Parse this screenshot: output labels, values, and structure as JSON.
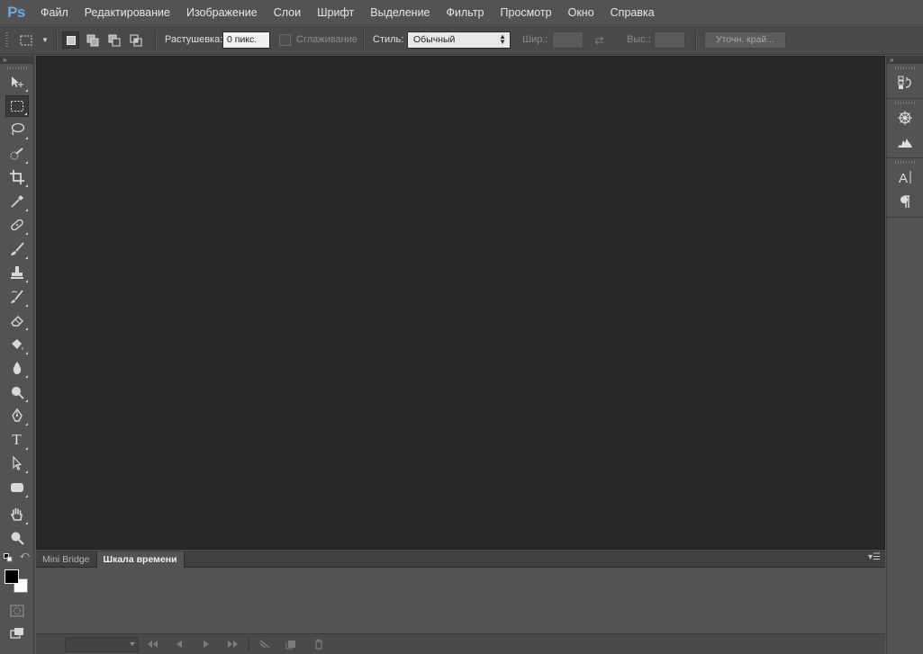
{
  "app": {
    "logo": "Ps"
  },
  "menu": [
    "Файл",
    "Редактирование",
    "Изображение",
    "Слои",
    "Шрифт",
    "Выделение",
    "Фильтр",
    "Просмотр",
    "Окно",
    "Справка"
  ],
  "options": {
    "feather_label": "Растушевка:",
    "feather_value": "0 пикс.",
    "antialias_label": "Сглаживание",
    "style_label": "Стиль:",
    "style_value": "Обычный",
    "width_label": "Шир.:",
    "height_label": "Выс.:",
    "refine_label": "Уточн. край..."
  },
  "toolbar": {
    "collapse": "»",
    "tools": [
      {
        "name": "move-tool",
        "active": false
      },
      {
        "name": "rect-marquee-tool",
        "active": true
      },
      {
        "name": "lasso-tool",
        "active": false
      },
      {
        "name": "quick-selection-tool",
        "active": false
      },
      {
        "name": "crop-tool",
        "active": false
      },
      {
        "name": "eyedropper-tool",
        "active": false
      },
      {
        "name": "healing-brush-tool",
        "active": false
      },
      {
        "name": "brush-tool",
        "active": false
      },
      {
        "name": "clone-stamp-tool",
        "active": false
      },
      {
        "name": "history-brush-tool",
        "active": false
      },
      {
        "name": "eraser-tool",
        "active": false
      },
      {
        "name": "paint-bucket-tool",
        "active": false
      },
      {
        "name": "blur-tool",
        "active": false
      },
      {
        "name": "dodge-tool",
        "active": false
      },
      {
        "name": "pen-tool",
        "active": false
      },
      {
        "name": "type-tool",
        "active": false
      },
      {
        "name": "path-selection-tool",
        "active": false
      },
      {
        "name": "rectangle-shape-tool",
        "active": false
      },
      {
        "name": "hand-tool",
        "active": false
      },
      {
        "name": "zoom-tool",
        "active": false
      }
    ],
    "foreground_color": "#000000",
    "background_color": "#ffffff"
  },
  "dock": {
    "collapse": "»",
    "icons": [
      "history-icon",
      "navigator-icon",
      "histogram-icon",
      "character-icon",
      "paragraph-icon"
    ]
  },
  "bottom_panel": {
    "tabs": [
      "Mini Bridge",
      "Шкала времени"
    ],
    "active_tab": "Шкала времени",
    "controls": [
      "first-frame-icon",
      "prev-frame-icon",
      "play-icon",
      "next-frame-icon",
      "tween-icon",
      "duplicate-frame-icon",
      "delete-frame-icon"
    ]
  },
  "colors": {
    "accent_logo": "#6fa7db",
    "canvas": "#282828",
    "chrome": "#535353"
  }
}
